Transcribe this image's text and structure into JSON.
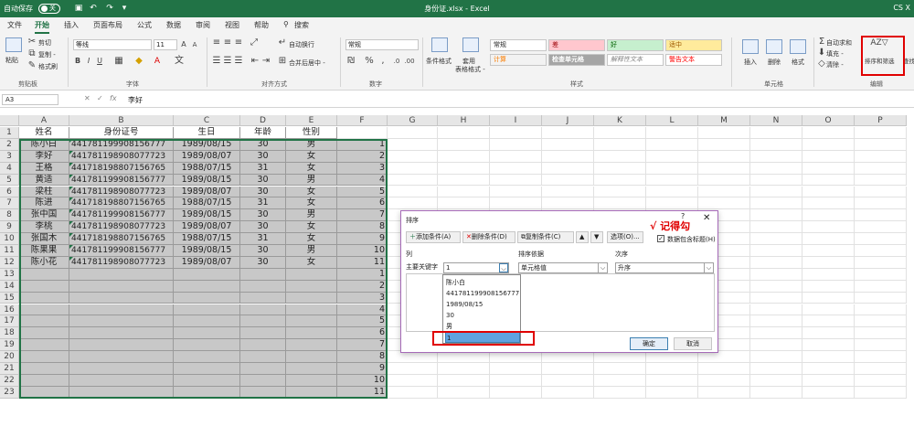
{
  "titlebar": {
    "autosave": "自动保存",
    "toggle": "关",
    "title": "身份证.xlsx  -  Excel",
    "user": "CS X"
  },
  "tabs": [
    "文件",
    "开始",
    "插入",
    "页面布局",
    "公式",
    "数据",
    "审阅",
    "视图",
    "帮助",
    "搜索"
  ],
  "ribbon": {
    "clipboard": {
      "cut": "剪切",
      "copy": "复制 -",
      "format_painter": "格式刷",
      "paste": "粘贴",
      "group": "剪贴板"
    },
    "font": {
      "name": "等线",
      "size": "11",
      "group": "字体"
    },
    "align": {
      "wrap": "自动换行",
      "merge": "合并后居中 -",
      "group": "对齐方式"
    },
    "number": {
      "format": "常规",
      "group": "数字"
    },
    "styles": {
      "cond": "条件格式",
      "table": "套用\n表格格式 -",
      "normal": "常规",
      "bad": "差",
      "good": "好",
      "neutral": "适中",
      "calc": "计算",
      "check": "检查单元格",
      "explain": "解释性文本",
      "warn": "警告文本",
      "group": "样式"
    },
    "cells": {
      "insert": "插入",
      "delete": "删除",
      "format": "格式",
      "group": "单元格"
    },
    "edit": {
      "autosum": "自动求和",
      "fill": "填充 -",
      "clear": "清除 -",
      "sort": "排序和筛选",
      "find": "查找",
      "group": "编辑"
    }
  },
  "formula_bar": {
    "name_box": "A3",
    "fx": "fx",
    "value": "李好"
  },
  "columns": [
    "A",
    "B",
    "C",
    "D",
    "E",
    "F",
    "G",
    "H",
    "I",
    "J",
    "K",
    "L",
    "M",
    "N",
    "O",
    "P"
  ],
  "headers": [
    "姓名",
    "身份证号",
    "生日",
    "年龄",
    "性别"
  ],
  "rows": [
    [
      "陈小白",
      "441781199908156777",
      "1989/08/15",
      "30",
      "男",
      "1"
    ],
    [
      "李好",
      "441781198908077723",
      "1989/08/07",
      "30",
      "女",
      "2"
    ],
    [
      "王格",
      "441718198807156765",
      "1988/07/15",
      "31",
      "女",
      "3"
    ],
    [
      "黄适",
      "441781199908156777",
      "1989/08/15",
      "30",
      "男",
      "4"
    ],
    [
      "梁柱",
      "441781198908077723",
      "1989/08/07",
      "30",
      "女",
      "5"
    ],
    [
      "陈进",
      "441718198807156765",
      "1988/07/15",
      "31",
      "女",
      "6"
    ],
    [
      "张中国",
      "441781199908156777",
      "1989/08/15",
      "30",
      "男",
      "7"
    ],
    [
      "李桃",
      "441781198908077723",
      "1989/08/07",
      "30",
      "女",
      "8"
    ],
    [
      "张国木",
      "441718198807156765",
      "1988/07/15",
      "31",
      "女",
      "9"
    ],
    [
      "陈果果",
      "441781199908156777",
      "1989/08/15",
      "30",
      "男",
      "10"
    ],
    [
      "陈小花",
      "441781198908077723",
      "1989/08/07",
      "30",
      "女",
      "11"
    ]
  ],
  "extra_f": [
    "1",
    "2",
    "3",
    "4",
    "5",
    "6",
    "7",
    "8",
    "9",
    "10",
    "11"
  ],
  "row_numbers": [
    "1",
    "2",
    "3",
    "4",
    "5",
    "6",
    "7",
    "8",
    "9",
    "10",
    "11",
    "12",
    "13",
    "14",
    "15",
    "16",
    "17",
    "18",
    "19",
    "20",
    "21",
    "22",
    "23"
  ],
  "dialog": {
    "title": "排序",
    "help": "?",
    "close": "✕",
    "add": "添加条件(A)",
    "delete": "删除条件(D)",
    "copy": "复制条件(C)",
    "options": "选项(O)...",
    "has_header": "数据包含标题(H)",
    "annotation": "√ 记得勾",
    "col_label": "列",
    "basis_label": "排序依据",
    "order_label": "次序",
    "primary": "主要关键字",
    "key_value": "1",
    "basis_value": "单元格值",
    "order_value": "升序",
    "dropdown": [
      "陈小白",
      "441781199908156777",
      "1989/08/15",
      "30",
      "男",
      "1"
    ],
    "ok": "确定",
    "cancel": "取消"
  }
}
